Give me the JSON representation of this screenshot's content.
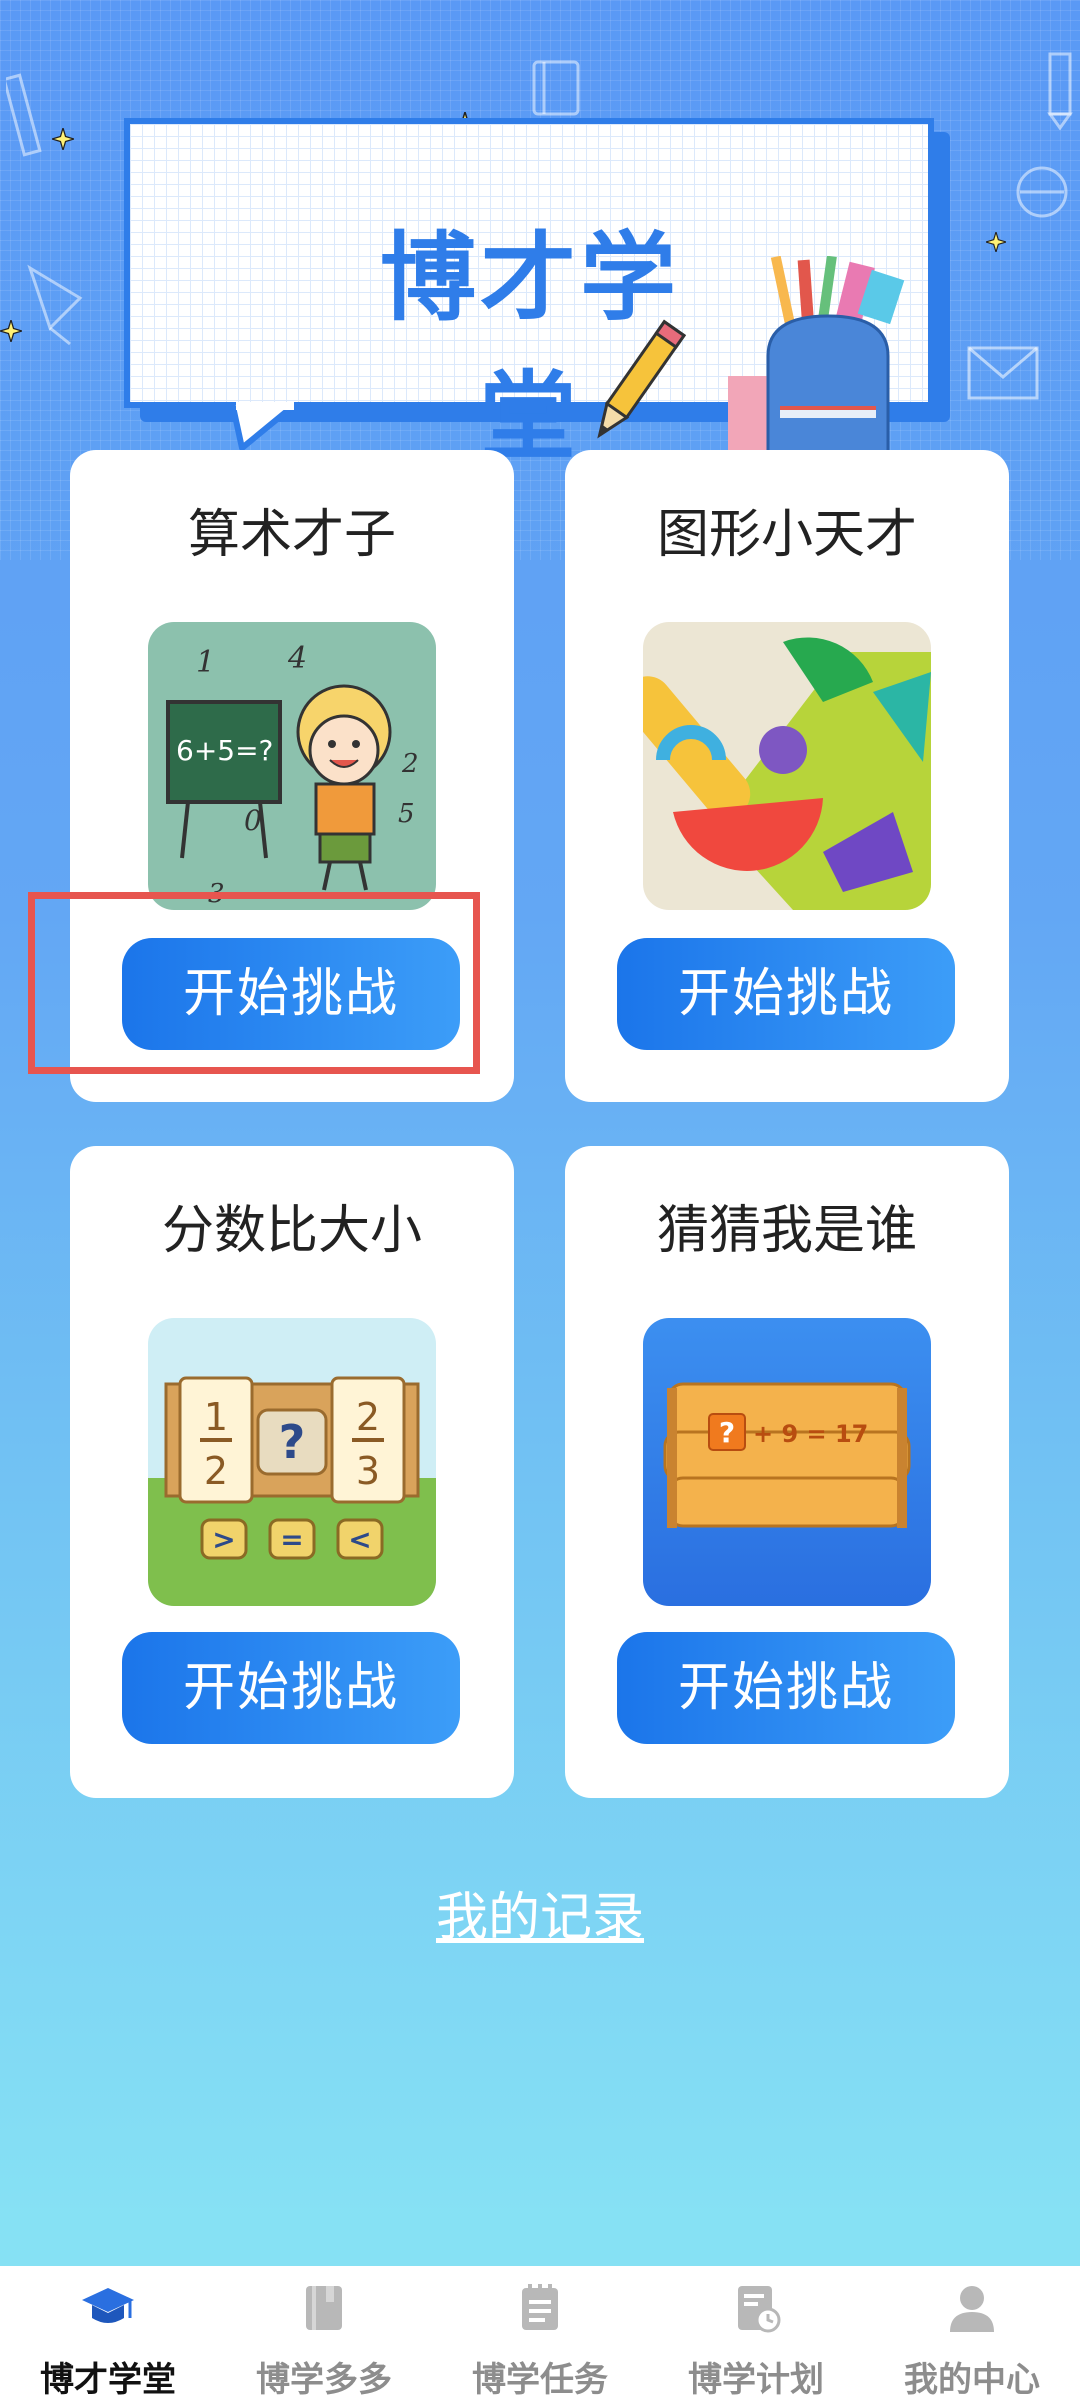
{
  "header": {
    "title": "博才学堂"
  },
  "cards": [
    {
      "title": "算术才子",
      "button": "开始挑战"
    },
    {
      "title": "图形小天才",
      "button": "开始挑战"
    },
    {
      "title": "分数比大小",
      "button": "开始挑战"
    },
    {
      "title": "猜猜我是谁",
      "button": "开始挑战"
    }
  ],
  "thumbs": {
    "arithmetic_board_text": "6+5=?",
    "fraction_left_num": "1",
    "fraction_left_den": "2",
    "fraction_right_num": "2",
    "fraction_right_den": "3",
    "fraction_question": "?",
    "compare_gt": ">",
    "compare_eq": "=",
    "compare_lt": "<",
    "guess_q": "?",
    "guess_equation": "+ 9 = 17"
  },
  "record_link": "我的记录",
  "tabbar": {
    "active_color": "#111111",
    "inactive_color": "#8d8d8d",
    "items": [
      {
        "label": "博才学堂",
        "icon": "graduation-cap-icon"
      },
      {
        "label": "博学多多",
        "icon": "book-icon"
      },
      {
        "label": "博学任务",
        "icon": "notepad-icon"
      },
      {
        "label": "博学计划",
        "icon": "plan-clock-icon"
      },
      {
        "label": "我的中心",
        "icon": "user-icon"
      }
    ]
  },
  "colors": {
    "accent": "#2f7de9",
    "highlight": "#e7554f"
  }
}
